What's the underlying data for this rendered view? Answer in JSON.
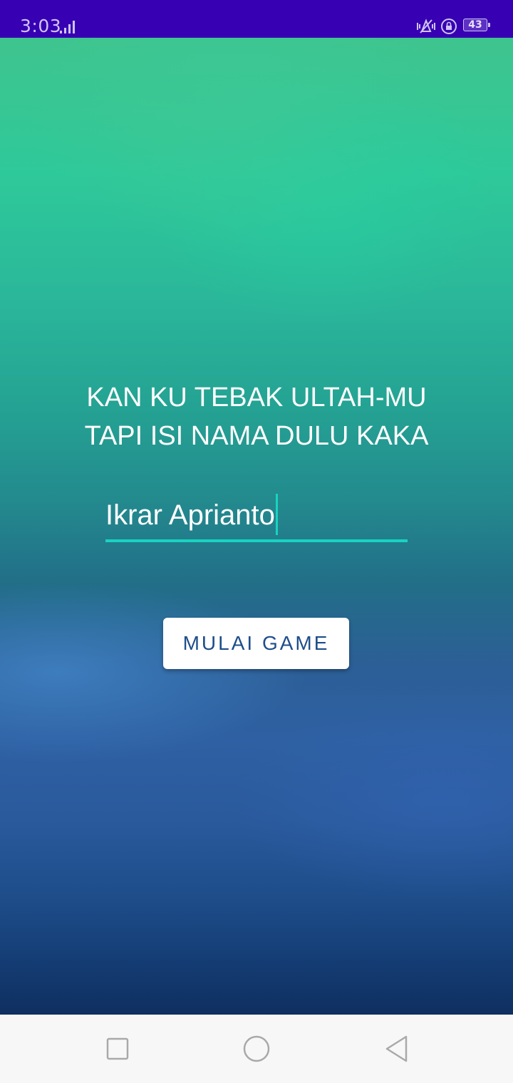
{
  "status_bar": {
    "time": "3:03",
    "battery_level": "43",
    "icons": [
      "signal-icon",
      "vibrate-icon",
      "rotation-lock-icon",
      "battery-icon"
    ],
    "background_color": "#3700b3"
  },
  "main": {
    "heading_line1": "KAN KU TEBAK ULTAH-MU",
    "heading_line2": "TAPI ISI NAMA DULU KAKA",
    "name_input": {
      "value": "Ikrar Aprianto",
      "accent_color": "#19d3c1"
    },
    "start_button_label": "MULAI GAME"
  },
  "nav_bar": {
    "buttons": [
      "recents-icon",
      "home-icon",
      "back-icon"
    ]
  }
}
